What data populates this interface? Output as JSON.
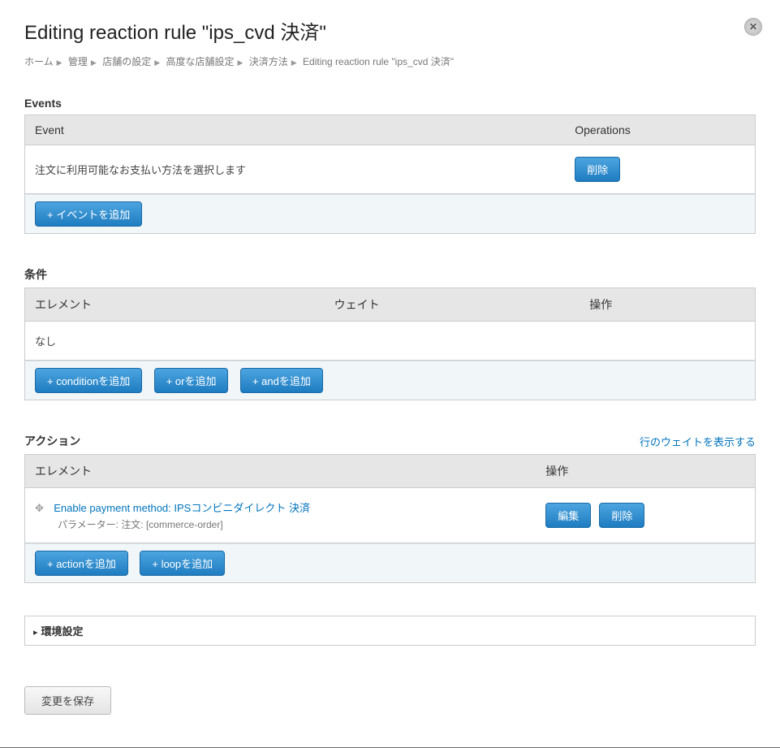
{
  "title": "Editing reaction rule \"ips_cvd 決済\"",
  "breadcrumb": {
    "items": [
      "ホーム",
      "管理",
      "店舗の設定",
      "高度な店舗設定",
      "決済方法"
    ],
    "current": "Editing reaction rule \"ips_cvd 決済\""
  },
  "events": {
    "heading": "Events",
    "col_event": "Event",
    "col_ops": "Operations",
    "row1_label": "注文に利用可能なお支払い方法を選択します",
    "delete_btn": "削除",
    "add_btn": "+  イベントを追加"
  },
  "conditions": {
    "heading": "条件",
    "col_element": "エレメント",
    "col_weight": "ウェイト",
    "col_ops": "操作",
    "none": "なし",
    "add_cond": "+  conditionを追加",
    "add_or": "+  orを追加",
    "add_and": "+  andを追加"
  },
  "actions": {
    "heading": "アクション",
    "show_weights": "行のウェイトを表示する",
    "col_element": "エレメント",
    "col_ops": "操作",
    "action_link": "Enable payment method: IPSコンビニダイレクト 決済",
    "param_label": "パラメーター: 注文: [commerce-order]",
    "edit_btn": "編集",
    "delete_btn": "削除",
    "add_action": "+  actionを追加",
    "add_loop": "+  loopを追加"
  },
  "settings": {
    "label": "環境設定"
  },
  "save": "変更を保存"
}
